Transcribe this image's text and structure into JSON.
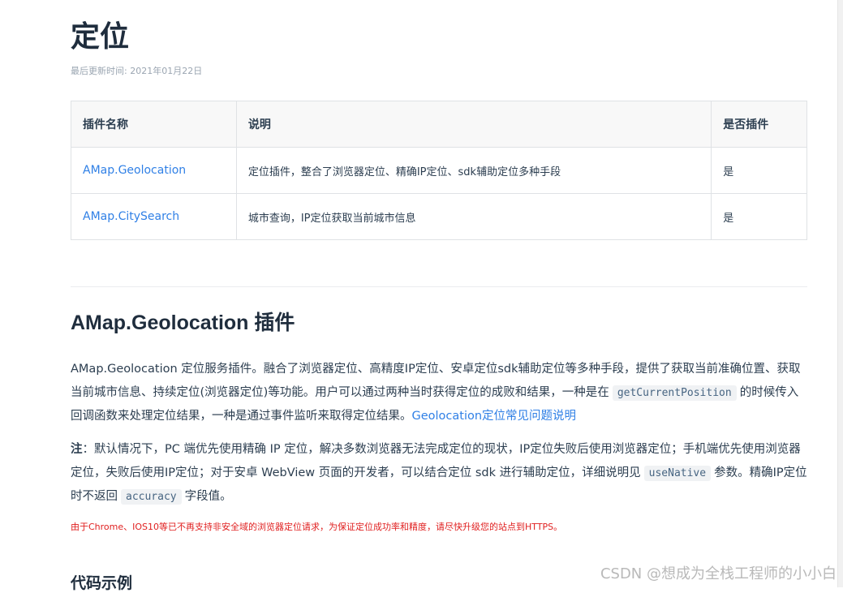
{
  "page": {
    "title": "定位",
    "updated": "最后更新时间: 2021年01月22日"
  },
  "table": {
    "headers": [
      "插件名称",
      "说明",
      "是否插件"
    ],
    "rows": [
      {
        "name": "AMap.Geolocation",
        "desc": "定位插件，整合了浏览器定位、精确IP定位、sdk辅助定位多种手段",
        "is_plugin": "是"
      },
      {
        "name": "AMap.CitySearch",
        "desc": "城市查询，IP定位获取当前城市信息",
        "is_plugin": "是"
      }
    ]
  },
  "section": {
    "title": "AMap.Geolocation 插件",
    "p1_a": "AMap.Geolocation 定位服务插件。融合了浏览器定位、高精度IP定位、安卓定位sdk辅助定位等多种手段，提供了获取当前准确位置、获取当前城市信息、持续定位(浏览器定位)等功能。用户可以通过两种当时获得定位的成败和结果，一种是在",
    "p1_code": "getCurrentPosition",
    "p1_b": "的时候传入回调函数来处理定位结果，一种是通过事件监听来取得定位结果。",
    "p1_link": "Geolocation定位常见问题说明",
    "p2_strong": "注",
    "p2_a": "：默认情况下，PC 端优先使用精确 IP 定位，解决多数浏览器无法完成定位的现状，IP定位失败后使用浏览器定位；手机端优先使用浏览器定位，失败后使用IP定位；对于安卓 WebView 页面的开发者，可以结合定位 sdk 进行辅助定位，详细说明见",
    "p2_code1": "useNative",
    "p2_b": "参数。精确IP定位时不返回",
    "p2_code2": "accuracy",
    "p2_c": "字段值。",
    "warning": "由于Chrome、IOS10等已不再支持非安全域的浏览器定位请求，为保证定位成功率和精度，请尽快升级您的站点到HTTPS。",
    "code_heading": "代码示例"
  },
  "watermark": "CSDN @想成为全栈工程师的小小白"
}
